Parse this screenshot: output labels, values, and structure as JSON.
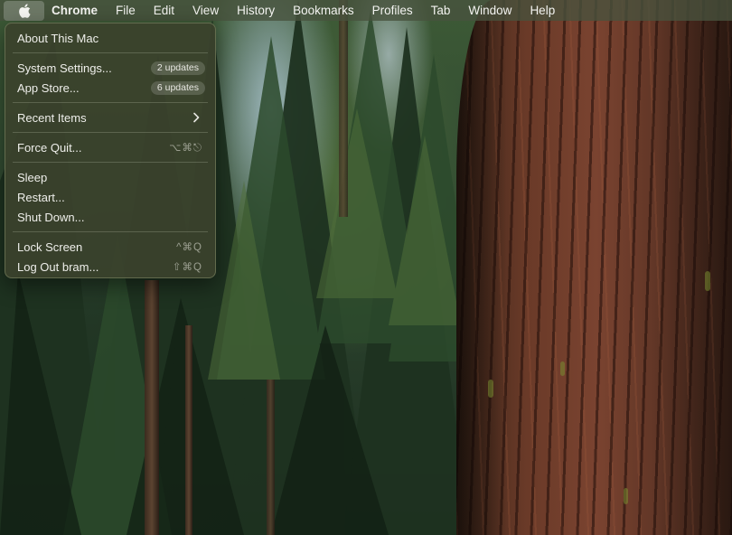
{
  "menubar": {
    "apple_icon": "apple-logo-icon",
    "app_name": "Chrome",
    "items": [
      "File",
      "Edit",
      "View",
      "History",
      "Bookmarks",
      "Profiles",
      "Tab",
      "Window",
      "Help"
    ]
  },
  "apple_menu": {
    "about": "About This Mac",
    "system_settings": {
      "label": "System Settings...",
      "badge": "2 updates"
    },
    "app_store": {
      "label": "App Store...",
      "badge": "6 updates"
    },
    "recent_items": {
      "label": "Recent Items",
      "icon": "chevron-right-icon"
    },
    "force_quit": {
      "label": "Force Quit...",
      "shortcut": "⌥⌘⎋"
    },
    "sleep": "Sleep",
    "restart": "Restart...",
    "shut_down": "Shut Down...",
    "lock_screen": {
      "label": "Lock Screen",
      "shortcut": "^⌘Q"
    },
    "log_out": {
      "label": "Log Out bram...",
      "shortcut": "⇧⌘Q"
    }
  },
  "colors": {
    "menubar_bg": "#48523e",
    "menu_bg": "#3a422c",
    "text": "#eeeeea"
  }
}
